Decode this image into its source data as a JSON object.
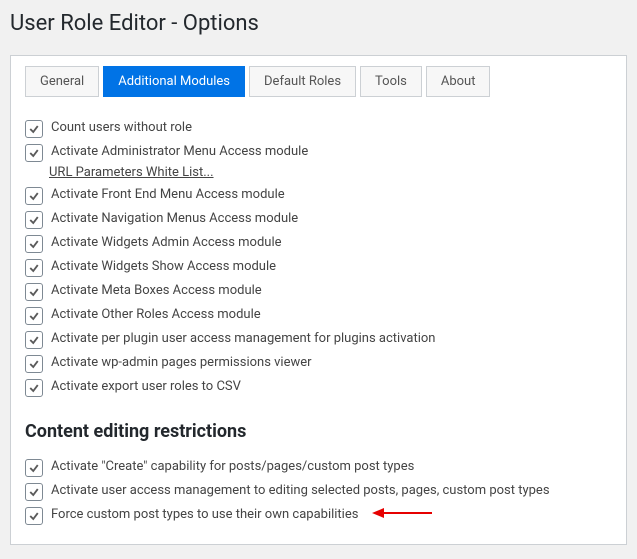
{
  "header": {
    "title": "User Role Editor - Options"
  },
  "tabs": [
    {
      "label": "General"
    },
    {
      "label": "Additional Modules"
    },
    {
      "label": "Default Roles"
    },
    {
      "label": "Tools"
    },
    {
      "label": "About"
    }
  ],
  "options_top": [
    {
      "label": "Count users without role"
    },
    {
      "label": "Activate Administrator Menu Access module",
      "sublink": "URL Parameters White List..."
    },
    {
      "label": "Activate Front End Menu Access module"
    },
    {
      "label": "Activate Navigation Menus Access module"
    },
    {
      "label": "Activate Widgets Admin Access module"
    },
    {
      "label": "Activate Widgets Show Access module"
    },
    {
      "label": "Activate Meta Boxes Access module"
    },
    {
      "label": "Activate Other Roles Access module"
    },
    {
      "label": "Activate per plugin user access management for plugins activation"
    },
    {
      "label": "Activate wp-admin pages permissions viewer"
    },
    {
      "label": "Activate export user roles to CSV"
    }
  ],
  "section2": {
    "title": "Content editing restrictions",
    "options": [
      {
        "label": "Activate \"Create\" capability for posts/pages/custom post types"
      },
      {
        "label": "Activate user access management to editing selected posts, pages, custom post types"
      },
      {
        "label": "Force custom post types to use their own capabilities",
        "arrow": true
      }
    ]
  }
}
